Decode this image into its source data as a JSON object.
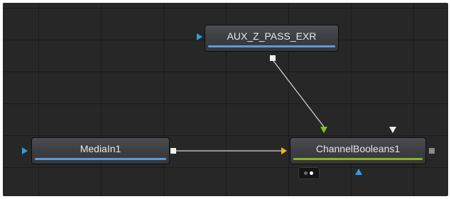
{
  "nodes": {
    "aux_z_pass": {
      "label": "AUX_Z_PASS_EXR",
      "bar_color": "#5d9bd4",
      "input_color": "#2d9ee8"
    },
    "mediain": {
      "label": "MediaIn1",
      "bar_color": "#5d9bd4",
      "input_color": "#2d9ee8"
    },
    "channel_booleans": {
      "label": "ChannelBooleans1",
      "bar_color": "#8cb22b",
      "background_input_color": "#f0b41e",
      "foreground_input_color": "#7cc41e",
      "effect_mask_input_color": "#2d9ee8"
    }
  },
  "connections": [
    {
      "from": "mediain",
      "to": "channel_booleans",
      "port": "background"
    },
    {
      "from": "aux_z_pass",
      "to": "channel_booleans",
      "port": "foreground"
    }
  ],
  "colors": {
    "canvas": "#272727",
    "grid": "#1b1b1b",
    "wire": "#d9d9d9"
  },
  "icons": {
    "view_toggle": "dual-dot-view-toggle-icon"
  }
}
